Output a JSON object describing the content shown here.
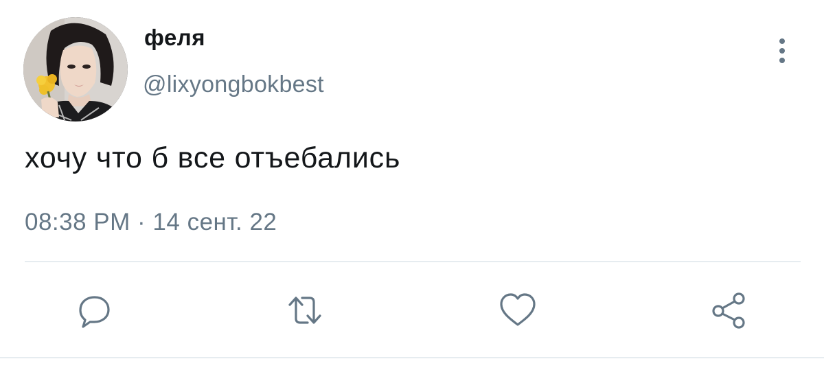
{
  "tweet": {
    "display_name": "феля",
    "handle": "@lixyongbokbest",
    "text": "хочу что б все отъебались",
    "timestamp": "08:38 PM · 14 сент. 22"
  },
  "icons": {
    "more": "more-vertical-icon",
    "reply": "reply-icon",
    "retweet": "retweet-icon",
    "like": "heart-icon",
    "share": "share-icon"
  },
  "colors": {
    "text_primary": "#14171a",
    "text_secondary": "#657786",
    "divider": "#e6ecf0",
    "icon": "#657786"
  }
}
